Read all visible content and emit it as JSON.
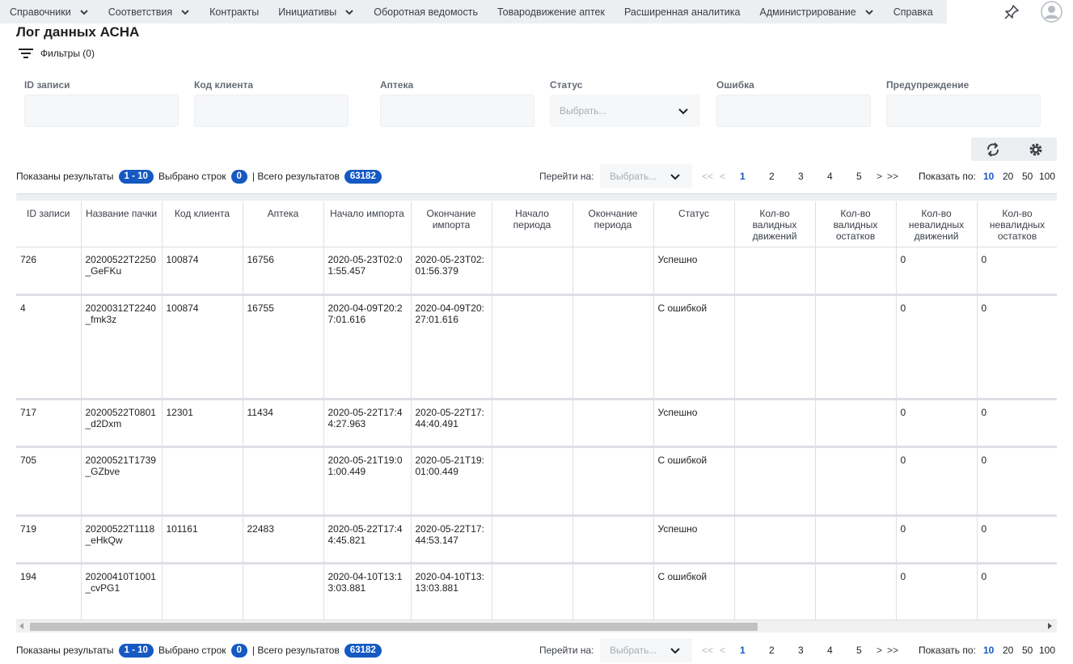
{
  "nav": {
    "items": [
      {
        "label": "Справочники",
        "dropdown": true
      },
      {
        "label": "Соответствия",
        "dropdown": true
      },
      {
        "label": "Контракты",
        "dropdown": false
      },
      {
        "label": "Инициативы",
        "dropdown": true
      },
      {
        "label": "Оборотная ведомость",
        "dropdown": false
      },
      {
        "label": "Товародвижение аптек",
        "dropdown": false
      },
      {
        "label": "Расширенная аналитика",
        "dropdown": false
      },
      {
        "label": "Администрирование",
        "dropdown": true
      },
      {
        "label": "Справка",
        "dropdown": false
      }
    ]
  },
  "page": {
    "title": "Лог данных АСНА",
    "filters_label": "Фильтры (0)"
  },
  "filters": {
    "record_id": "ID записи",
    "client_code": "Код клиента",
    "pharmacy": "Аптека",
    "status": "Статус",
    "status_placeholder": "Выбрать...",
    "error": "Ошибка",
    "warning": "Предупреждение"
  },
  "pager": {
    "shown_label": "Показаны результаты",
    "shown_range": "1 - 10",
    "selected_label": "Выбрано строк",
    "selected_count": "0",
    "total_label": "| Всего результатов",
    "total_count": "63182",
    "goto_label": "Перейти на:",
    "goto_placeholder": "Выбрать...",
    "first": "<<",
    "prev": "<",
    "pages": [
      "1",
      "2",
      "3",
      "4",
      "5"
    ],
    "next": ">",
    "last": ">>",
    "show_label": "Показать по:",
    "sizes": [
      "10",
      "20",
      "50",
      "100"
    ],
    "active_page": "1",
    "active_size": "10"
  },
  "table": {
    "columns": [
      "ID записи",
      "Название пачки",
      "Код клиента",
      "Аптека",
      "Начало импорта",
      "Окончание импорта",
      "Начало периода",
      "Окончание периода",
      "Статус",
      "Кол-во валидных движений",
      "Кол-во валидных остатков",
      "Кол-во невалидных движений",
      "Кол-во невалидных остатков"
    ],
    "rows": [
      [
        "726",
        "20200522T2250_GeFKu",
        "100874",
        "16756",
        "2020-05-23T02:01:55.457",
        "2020-05-23T02:01:56.379",
        "",
        "",
        "Успешно",
        "",
        "",
        "0",
        "0"
      ],
      [
        "4",
        "20200312T2240_fmk3z",
        "100874",
        "16755",
        "2020-04-09T20:27:01.616",
        "2020-04-09T20:27:01.616",
        "",
        "",
        "С ошибкой",
        "",
        "",
        "0",
        "0"
      ],
      [
        "717",
        "20200522T0801_d2Dxm",
        "12301",
        "11434",
        "2020-05-22T17:44:27.963",
        "2020-05-22T17:44:40.491",
        "",
        "",
        "Успешно",
        "",
        "",
        "0",
        "0"
      ],
      [
        "705",
        "20200521T1739_GZbve",
        "",
        "",
        "2020-05-21T19:01:00.449",
        "2020-05-21T19:01:00.449",
        "",
        "",
        "С ошибкой",
        "",
        "",
        "0",
        "0"
      ],
      [
        "719",
        "20200522T1118_eHkQw",
        "101161",
        "22483",
        "2020-05-22T17:44:45.821",
        "2020-05-22T17:44:53.147",
        "",
        "",
        "Успешно",
        "",
        "",
        "0",
        "0"
      ],
      [
        "194",
        "20200410T1001_cvPG1",
        "",
        "",
        "2020-04-10T13:13:03.881",
        "2020-04-10T13:13:03.881",
        "",
        "",
        "С ошибкой",
        "",
        "",
        "0",
        "0"
      ]
    ]
  },
  "colors": {
    "accent": "#1559c2",
    "nav_bg": "#eceef1",
    "input_bg": "#f6f7f9"
  }
}
